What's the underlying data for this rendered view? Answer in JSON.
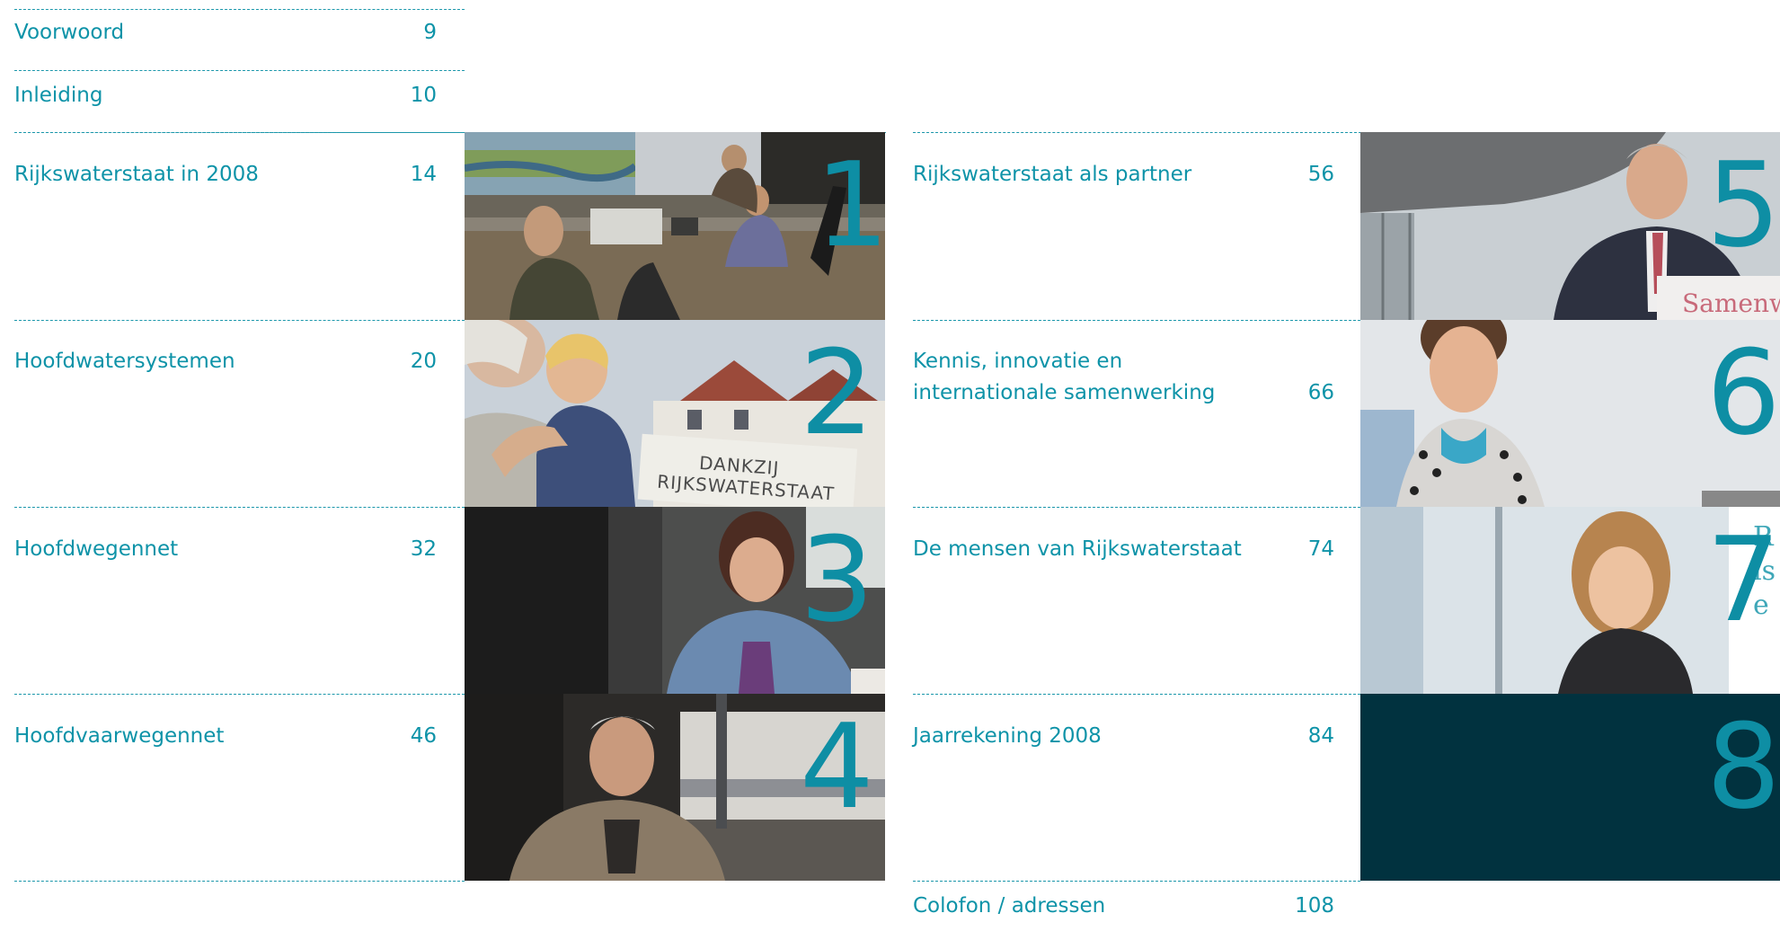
{
  "toc": {
    "voorwoord": {
      "title": "Voorwoord",
      "page": "9"
    },
    "inleiding": {
      "title": "Inleiding",
      "page": "10"
    },
    "chapters": [
      {
        "num": "1",
        "title": "Rijkswaterstaat in 2008",
        "page": "14"
      },
      {
        "num": "2",
        "title": "Hoofdwatersystemen",
        "page": "20"
      },
      {
        "num": "3",
        "title": "Hoofdwegennet",
        "page": "32"
      },
      {
        "num": "4",
        "title": "Hoofdvaarwegennet",
        "page": "46"
      },
      {
        "num": "5",
        "title": "Rijkswaterstaat als partner",
        "page": "56"
      },
      {
        "num": "6",
        "title_line1": "Kennis, innovatie en",
        "title_line2": "internationale samenwerking",
        "page": "66"
      },
      {
        "num": "7",
        "title": "De mensen van Rijkswaterstaat",
        "page": "74"
      },
      {
        "num": "8",
        "title": "Jaarrekening 2008",
        "page": "84"
      }
    ],
    "colofon": {
      "title": "Colofon / adressen",
      "page": "108"
    }
  },
  "photo_text": {
    "sign2": "DANKZIJ RIJKSWATERSTAAT",
    "sign5": "Samenw",
    "sign7": "R is e"
  },
  "colors": {
    "accent": "#0e93a8",
    "dark_panel": "#01323f"
  },
  "icons": [
    "photo-control-room",
    "photo-grandfather-child",
    "photo-driver-woman",
    "photo-skipper-man",
    "photo-speaker",
    "photo-woman-6",
    "photo-woman-7"
  ]
}
